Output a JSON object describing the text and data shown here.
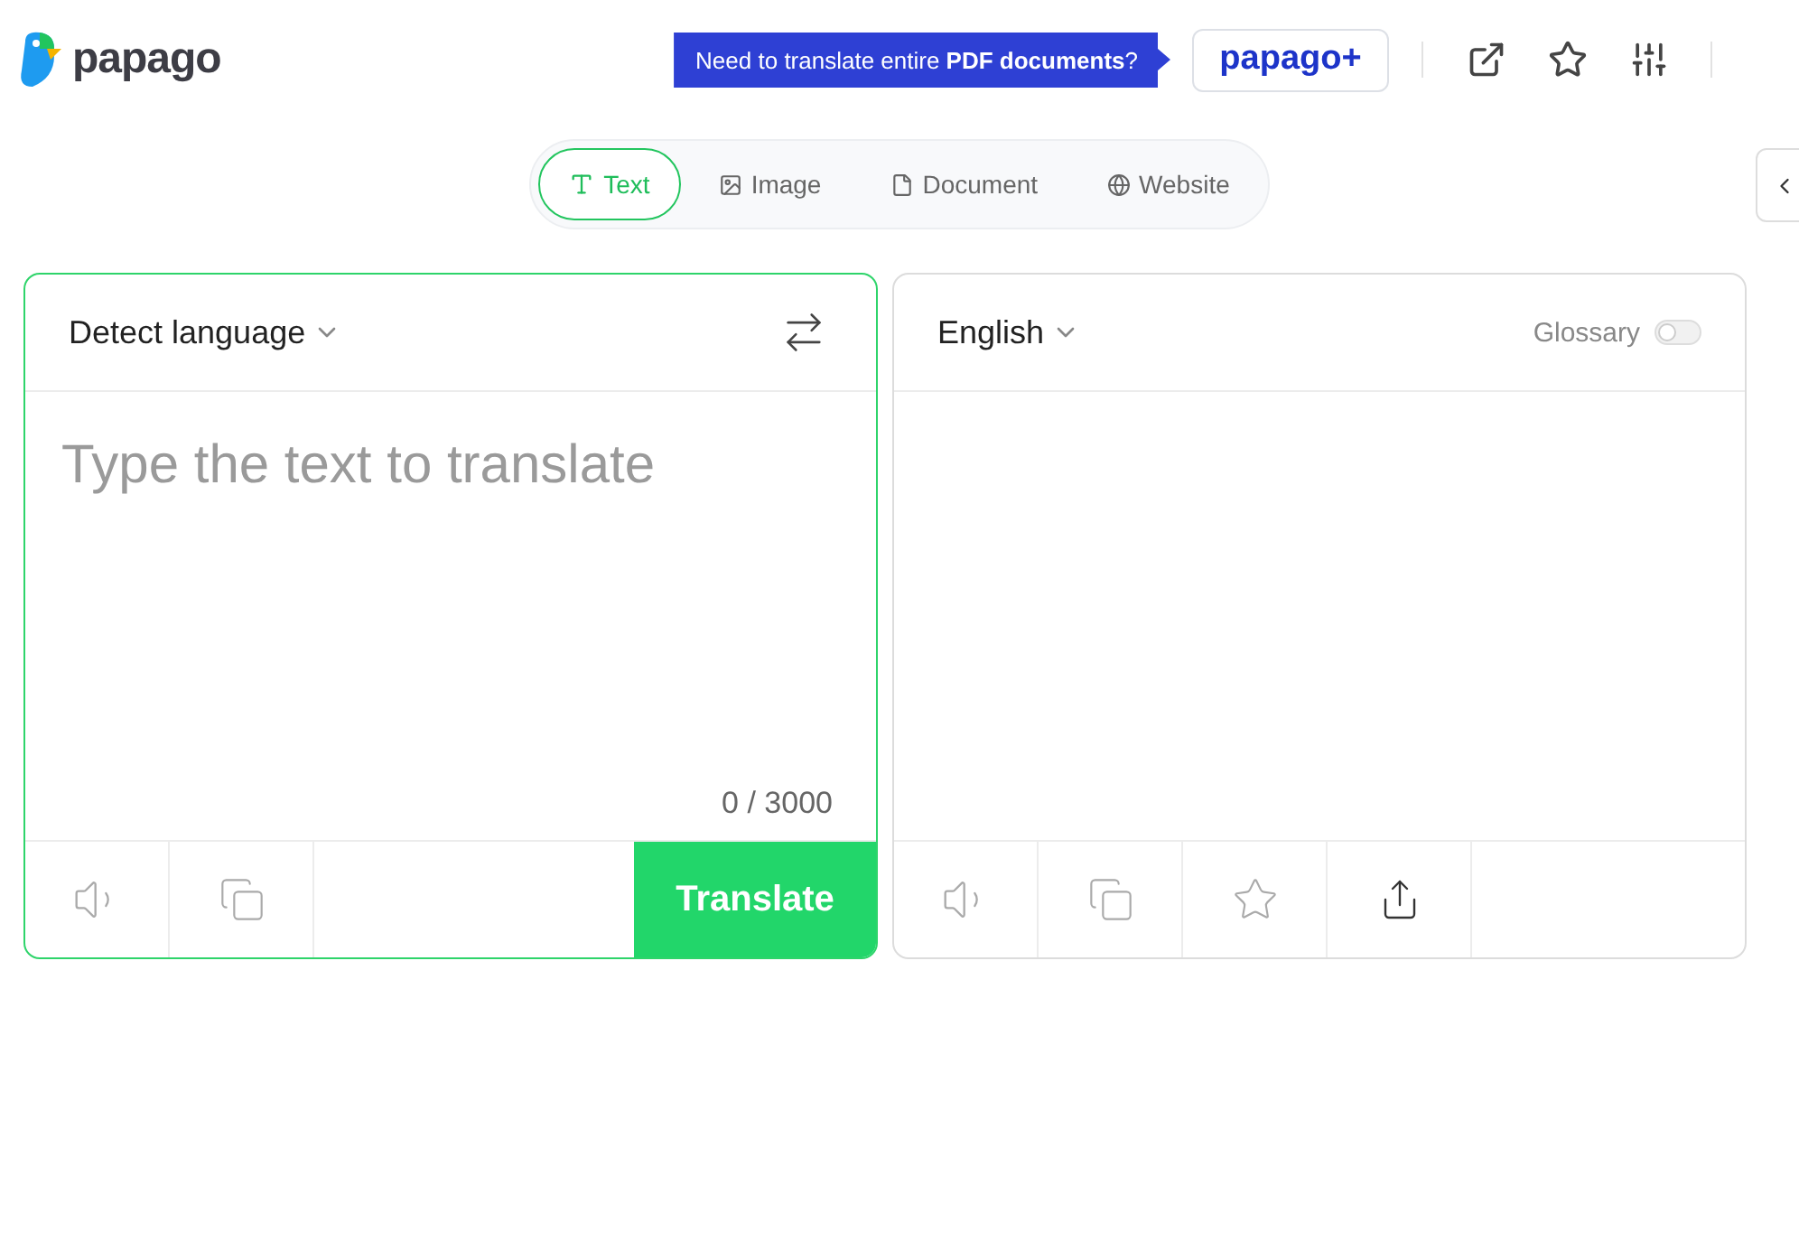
{
  "header": {
    "logo": "papago",
    "promo": "Need to translate entire **PDF documents**?",
    "plus_button": "papago+"
  },
  "modes": [
    {
      "label": "Text",
      "kind": "text",
      "selected": true
    },
    {
      "label": "Image",
      "kind": "image",
      "selected": false
    },
    {
      "label": "Document",
      "kind": "document",
      "selected": false
    },
    {
      "label": "Website",
      "kind": "website",
      "selected": false
    }
  ],
  "source": {
    "language": "Detect language",
    "placeholder": "Type the text to translate",
    "counter": "0 / 3000",
    "translate_button": "Translate"
  },
  "target": {
    "language": "English",
    "glossary": {
      "label": "Glossary",
      "on": false
    }
  }
}
